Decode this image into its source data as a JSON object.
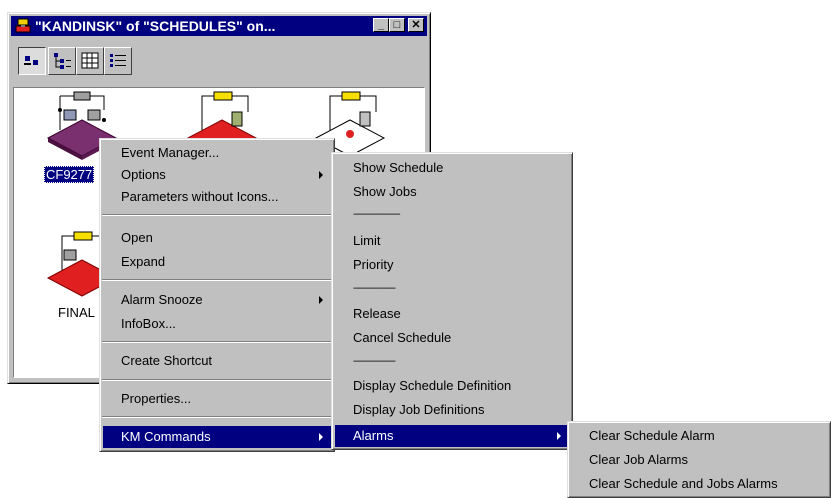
{
  "window": {
    "title": "\"KANDINSK\" of \"SCHEDULES\" on...",
    "controls": {
      "minimize": "_",
      "maximize": "□",
      "close": "✕"
    },
    "toolbar": [
      {
        "icon": "large-icons-view-icon",
        "pressed": true
      },
      {
        "icon": "tree-view-icon",
        "pressed": false
      },
      {
        "icon": "grid-view-icon",
        "pressed": false
      },
      {
        "icon": "details-view-icon",
        "pressed": false
      }
    ],
    "objects": [
      {
        "label": "CF9277",
        "selected": true,
        "color": "#7a2f6f"
      },
      {
        "label": "",
        "selected": false,
        "color": "#e02020"
      },
      {
        "label": "",
        "selected": false,
        "color": "#ffffff"
      },
      {
        "label": "",
        "selected": false,
        "color": "#e02020"
      },
      {
        "label": "FINAL",
        "selected": false,
        "color": "#ffffff"
      }
    ]
  },
  "context_menu": {
    "items": {
      "event_manager": "Event Manager...",
      "options": "Options",
      "params_no_icons": "Parameters without Icons...",
      "open": "Open",
      "expand": "Expand",
      "alarm_snooze": "Alarm Snooze",
      "infobox": "InfoBox...",
      "create_shortcut": "Create Shortcut",
      "properties": "Properties...",
      "km_commands": "KM Commands"
    }
  },
  "km_submenu": {
    "items": {
      "show_schedule": "Show Schedule",
      "show_jobs": "Show Jobs",
      "dash1": "--------------------",
      "limit": "Limit",
      "priority": "Priority",
      "dash2": "------------------",
      "release": "Release",
      "cancel_schedule": "Cancel Schedule",
      "dash3": "------------------",
      "display_schedule_def": "Display Schedule Definition",
      "display_job_defs": "Display Job Definitions",
      "alarms": "Alarms"
    }
  },
  "alarms_submenu": {
    "items": {
      "clear_schedule_alarm": "Clear Schedule Alarm",
      "clear_job_alarms": "Clear Job Alarms",
      "clear_schedule_and_jobs_alarms": "Clear Schedule and Jobs Alarms"
    }
  },
  "colors": {
    "selection": "#000080",
    "menu_bg": "#c0c0c0",
    "accent_yellow": "#f5e000"
  }
}
